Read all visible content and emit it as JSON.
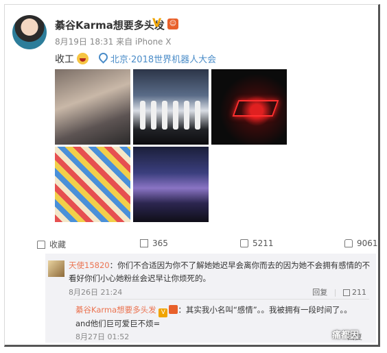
{
  "post": {
    "author": "綦谷Karma想要多头发",
    "verified_badge": "V",
    "meta": "8月19日 18:31 来自 iPhone X",
    "content": "收工",
    "location": "北京·2018世界机器人大会"
  },
  "actions": {
    "favorite": "收藏",
    "repost_count": "365",
    "comment_count": "5211",
    "like_count": "9061"
  },
  "comment": {
    "username": "天使15820",
    "text": "：你们不合适因为你不了解她她迟早会离你而去的因为她不会拥有感情的不看好你们小心她粉丝会迟早让你烦死的。",
    "date": "8月26日 21:24",
    "reply_label": "回复",
    "like_count": "211"
  },
  "reply": {
    "username": "綦谷Karma想要多头发",
    "text": "：其实我小名叫“感情”。。我被拥有一段时间了。。and他们巨可爱巨不烦=",
    "date": "8月27日 01:52",
    "reply_label": "回复"
  },
  "watermark": "痛都因",
  "colors": {
    "link": "#4a8cc8",
    "username": "#eb7350",
    "badge": "#f0a400"
  }
}
